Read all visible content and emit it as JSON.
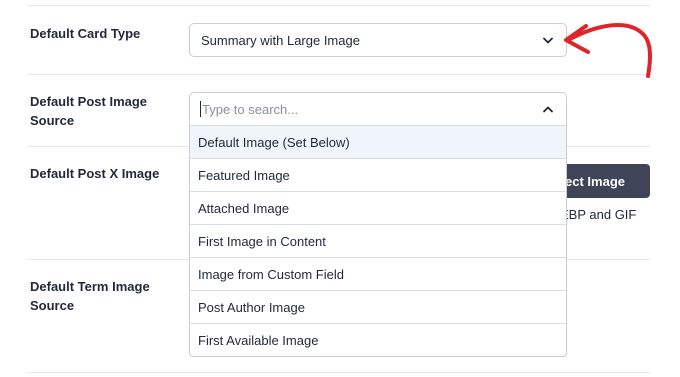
{
  "rows": {
    "card_type": {
      "label_line1": "Default Card Type",
      "selected_value": "Summary with Large Image"
    },
    "post_image_source": {
      "label_line1": "Default Post Image",
      "label_line2": "Source",
      "search_placeholder": "Type to search...",
      "options": [
        "Default Image (Set Below)",
        "Featured Image",
        "Attached Image",
        "First Image in Content",
        "Image from Custom Field",
        "Post Author Image",
        "First Available Image"
      ]
    },
    "post_x_image": {
      "label_line1": "Default Post X Image",
      "button_label": "lect Image",
      "formats_text": "EBP and GIF"
    },
    "term_image_source": {
      "label_line1": "Default Term Image",
      "label_line2": "Source"
    }
  },
  "colors": {
    "annotation_arrow": "#e0242a",
    "button_bg": "#3f4456",
    "highlight_option": "#f0f4fb"
  },
  "icons": {
    "select_chevron": "chevron-down-icon",
    "search_chevron": "chevron-up-icon",
    "annotation": "red-arrow-icon"
  }
}
